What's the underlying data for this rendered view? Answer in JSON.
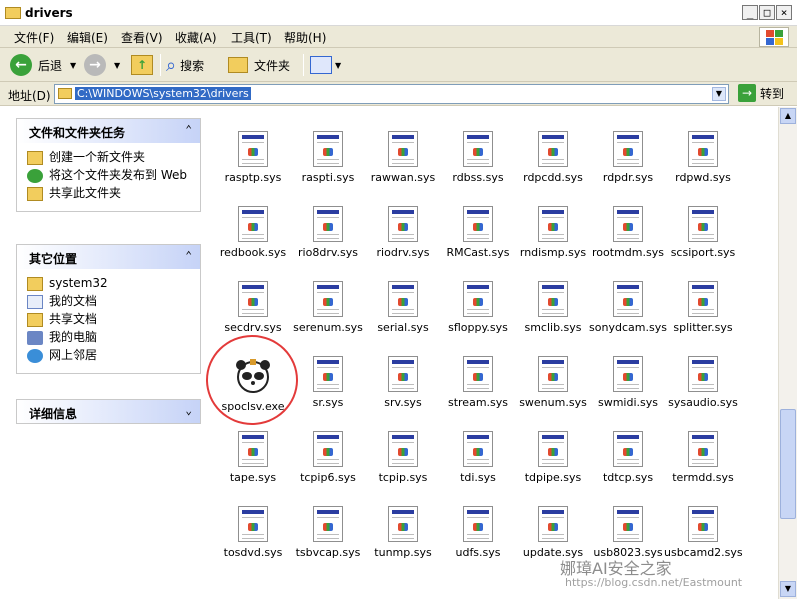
{
  "window": {
    "title": "drivers",
    "controls": [
      "_",
      "□",
      "×"
    ]
  },
  "menubar": {
    "items": [
      "文件(F)",
      "编辑(E)",
      "查看(V)",
      "收藏(A)",
      "工具(T)",
      "帮助(H)"
    ]
  },
  "toolbar": {
    "back_label": "后退",
    "search_label": "搜索",
    "folders_label": "文件夹"
  },
  "address": {
    "label": "地址(D)",
    "value": "C:\\WINDOWS\\system32\\drivers",
    "go_label": "转到"
  },
  "tasks_panel": {
    "title": "文件和文件夹任务",
    "items": [
      "创建一个新文件夹",
      "将这个文件夹发布到 Web",
      "共享此文件夹"
    ]
  },
  "places_panel": {
    "title": "其它位置",
    "items": [
      "system32",
      "我的文档",
      "共享文档",
      "我的电脑",
      "网上邻居"
    ]
  },
  "details_panel": {
    "title": "详细信息"
  },
  "files": [
    "rasptp.sys",
    "raspti.sys",
    "rawwan.sys",
    "rdbss.sys",
    "rdpcdd.sys",
    "rdpdr.sys",
    "rdpwd.sys",
    "redbook.sys",
    "rio8drv.sys",
    "riodrv.sys",
    "RMCast.sys",
    "rndismp.sys",
    "rootmdm.sys",
    "scsiport.sys",
    "secdrv.sys",
    "serenum.sys",
    "serial.sys",
    "sfloppy.sys",
    "smclib.sys",
    "sonydcam.sys",
    "splitter.sys",
    "spoclsv.exe",
    "sr.sys",
    "srv.sys",
    "stream.sys",
    "swenum.sys",
    "swmidi.sys",
    "sysaudio.sys",
    "tape.sys",
    "tcpip6.sys",
    "tcpip.sys",
    "tdi.sys",
    "tdpipe.sys",
    "tdtcp.sys",
    "termdd.sys",
    "tosdvd.sys",
    "tsbvcap.sys",
    "tunmp.sys",
    "udfs.sys",
    "update.sys",
    "usb8023.sys",
    "usbcamd2.sys"
  ],
  "watermark": {
    "text": "娜璋AI安全之家",
    "url": "https://blog.csdn.net/Eastmount"
  }
}
